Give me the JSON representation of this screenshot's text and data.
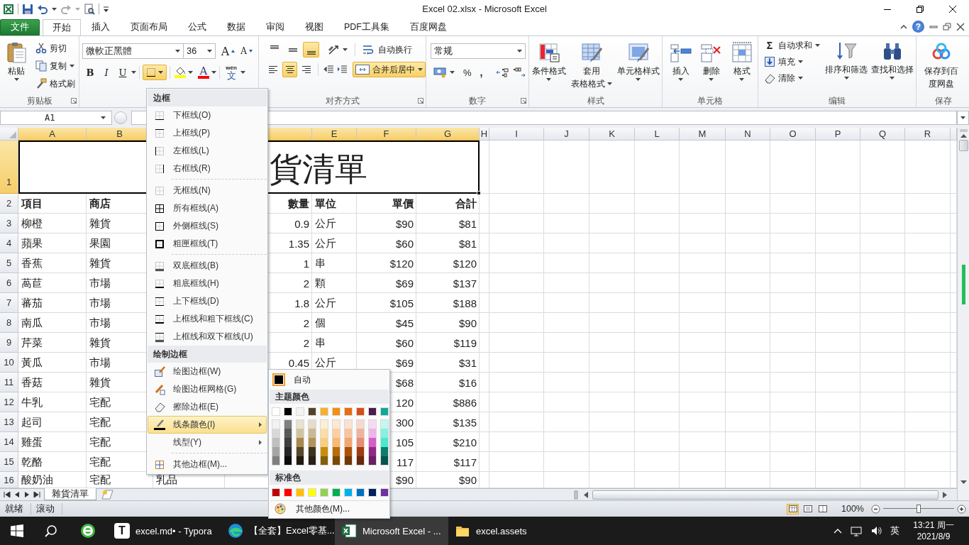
{
  "window": {
    "title": "Excel 02.xlsx - Microsoft Excel"
  },
  "tabs": [
    {
      "label": "文件",
      "kind": "file",
      "selected": false
    },
    {
      "label": "开始",
      "kind": "tab",
      "selected": true
    },
    {
      "label": "插入",
      "kind": "tab",
      "selected": false
    },
    {
      "label": "页面布局",
      "kind": "tab",
      "selected": false
    },
    {
      "label": "公式",
      "kind": "tab",
      "selected": false
    },
    {
      "label": "数据",
      "kind": "tab",
      "selected": false
    },
    {
      "label": "审阅",
      "kind": "tab",
      "selected": false
    },
    {
      "label": "视图",
      "kind": "tab",
      "selected": false
    },
    {
      "label": "PDF工具集",
      "kind": "tab",
      "selected": false
    },
    {
      "label": "百度网盘",
      "kind": "tab",
      "selected": false
    }
  ],
  "help": "?",
  "ribbon": {
    "groups": [
      {
        "kind": "clipboard",
        "label": "剪贴板",
        "launcher": true,
        "paste": "粘贴",
        "small": [
          {
            "label": "剪切",
            "dropdown": false
          },
          {
            "label": "复制",
            "dropdown": true
          },
          {
            "label": "格式刷",
            "dropdown": false
          }
        ]
      },
      {
        "kind": "font",
        "launcher": false,
        "font": "微軟正黑體",
        "size": "36",
        "grow": "A",
        "shrink": "A",
        "styles": [
          "B",
          "I",
          "U"
        ],
        "border_open": true,
        "fill": {
          "color": "#ffff00"
        },
        "font_color": {
          "label": "A",
          "color": "#ff0000"
        },
        "phonetic": [
          "wén",
          "文"
        ]
      },
      {
        "kind": "alignment",
        "label": "对齐方式",
        "launcher": true,
        "vertical": [
          {
            "on": false
          },
          {
            "on": false
          },
          {
            "on": true
          }
        ],
        "horizontal": [
          {
            "on": false
          },
          {
            "on": true
          },
          {
            "on": false
          }
        ],
        "wrap": "自动换行",
        "merge": {
          "label": "合并后居中",
          "on": true
        }
      },
      {
        "kind": "number",
        "label": "数字",
        "launcher": true,
        "format": "常规",
        "percent": "%",
        "comma": ","
      },
      {
        "kind": "large",
        "label": "样式",
        "launcher": false,
        "buttons": [
          {
            "lines": [
              "条件格式"
            ],
            "dropdown": true
          },
          {
            "lines": [
              "套用",
              "表格格式"
            ],
            "dropdown": true
          },
          {
            "lines": [
              "单元格样式"
            ],
            "dropdown": true
          }
        ]
      },
      {
        "kind": "cells",
        "label": "单元格",
        "launcher": false,
        "buttons": [
          {
            "lines": [
              "插入"
            ],
            "dropdown": true
          },
          {
            "lines": [
              "删除"
            ],
            "dropdown": true
          },
          {
            "lines": [
              "格式"
            ],
            "dropdown": true
          }
        ]
      },
      {
        "kind": "editing",
        "label": "编辑",
        "launcher": false,
        "sigma": "Σ",
        "small": [
          {
            "label": "自动求和",
            "dropdown": true
          },
          {
            "label": "填充",
            "dropdown": true
          },
          {
            "label": "清除",
            "dropdown": true
          }
        ],
        "buttons": [
          {
            "lines": [
              "排序和筛选"
            ],
            "dropdown": true
          },
          {
            "lines": [
              "查找和选择"
            ],
            "dropdown": true
          }
        ]
      },
      {
        "kind": "save",
        "label": "保存",
        "launcher": false,
        "buttons": [
          {
            "lines": [
              "保存到百",
              "度网盘"
            ],
            "dropdown": false
          }
        ]
      }
    ]
  },
  "formula_bar": {
    "name_box": "A1"
  },
  "sheet": {
    "columns": [
      {
        "label": "A",
        "selected": true
      },
      {
        "label": "B",
        "selected": true
      },
      {
        "selected": true
      },
      {
        "label": "E",
        "selected": true
      },
      {
        "label": "F",
        "selected": true
      },
      {
        "label": "G",
        "selected": true
      },
      {
        "label": "H",
        "selected": false
      },
      {
        "label": "I",
        "selected": false
      },
      {
        "label": "J",
        "selected": false
      },
      {
        "label": "K",
        "selected": false
      },
      {
        "label": "L",
        "selected": false
      },
      {
        "label": "M",
        "selected": false
      },
      {
        "label": "N",
        "selected": false
      },
      {
        "label": "O",
        "selected": false
      },
      {
        "label": "P",
        "selected": false
      },
      {
        "label": "Q",
        "selected": false
      },
      {
        "label": "R",
        "selected": false
      }
    ],
    "title_row": {
      "number": "1",
      "selected": true,
      "title": "貨清單"
    },
    "rows": [
      {
        "number": "2",
        "selected": false,
        "kind": "header",
        "cells": [
          "項目",
          "商店",
          null,
          "數量",
          "單位",
          "單價",
          "合計"
        ]
      },
      {
        "number": "3",
        "selected": false,
        "kind": "data",
        "cells": [
          "柳橙",
          "雜貨",
          null,
          "0.9",
          "公斤",
          "$90",
          "$81"
        ]
      },
      {
        "number": "4",
        "selected": false,
        "kind": "data",
        "cells": [
          "蘋果",
          "果園",
          null,
          "1.35",
          "公斤",
          "$60",
          "$81"
        ]
      },
      {
        "number": "5",
        "selected": false,
        "kind": "data",
        "cells": [
          "香蕉",
          "雜貨",
          null,
          "1",
          "串",
          "$120",
          "$120"
        ]
      },
      {
        "number": "6",
        "selected": false,
        "kind": "data",
        "cells": [
          "萵苣",
          "市場",
          null,
          "2",
          "顆",
          "$69",
          "$137"
        ]
      },
      {
        "number": "7",
        "selected": false,
        "kind": "data",
        "cells": [
          "蕃茄",
          "市場",
          null,
          "1.8",
          "公斤",
          "$105",
          "$188"
        ]
      },
      {
        "number": "8",
        "selected": false,
        "kind": "data",
        "cells": [
          "南瓜",
          "市場",
          null,
          "2",
          "個",
          "$45",
          "$90"
        ]
      },
      {
        "number": "9",
        "selected": false,
        "kind": "data",
        "cells": [
          "芹菜",
          "雜貨",
          null,
          "2",
          "串",
          "$60",
          "$119"
        ]
      },
      {
        "number": "10",
        "selected": false,
        "kind": "data",
        "cells": [
          "黃瓜",
          "市場",
          null,
          "0.45",
          "公斤",
          "$69",
          "$31"
        ]
      },
      {
        "number": "11",
        "selected": false,
        "kind": "data",
        "cells": [
          "香菇",
          "雜貨",
          null,
          null,
          null,
          "$68",
          "$16"
        ]
      },
      {
        "number": "12",
        "selected": false,
        "kind": "data",
        "cells": [
          "牛乳",
          "宅配",
          null,
          null,
          null,
          "120",
          "$886"
        ]
      },
      {
        "number": "13",
        "selected": false,
        "kind": "data",
        "cells": [
          "起司",
          "宅配",
          null,
          null,
          null,
          "300",
          "$135"
        ]
      },
      {
        "number": "14",
        "selected": false,
        "kind": "data",
        "cells": [
          "雞蛋",
          "宅配",
          null,
          null,
          null,
          "105",
          "$210"
        ]
      },
      {
        "number": "15",
        "selected": false,
        "kind": "data",
        "cells": [
          "乾酪",
          "宅配",
          null,
          null,
          null,
          "117",
          "$117"
        ]
      },
      {
        "number": "16",
        "selected": false,
        "kind": "data",
        "cells": [
          "酸奶油",
          "宅配",
          "乳品",
          null,
          null,
          "$90",
          "$90"
        ]
      }
    ],
    "sheet_tabs": [
      {
        "label": "雜貨清單",
        "selected": true
      }
    ]
  },
  "status_bar": {
    "items": [
      "就绪",
      "滚动"
    ],
    "views": [
      {
        "selected": true
      },
      {
        "selected": false
      },
      {
        "selected": false
      }
    ],
    "zoom": {
      "label": "100%",
      "level": 0.5
    }
  },
  "border_menu": {
    "sections": [
      {
        "title": "边框",
        "items": [
          {
            "kind": "item",
            "label": "下框线(O)",
            "selected": false,
            "has_submenu": false
          },
          {
            "kind": "item",
            "label": "上框线(P)",
            "selected": false,
            "has_submenu": false
          },
          {
            "kind": "item",
            "label": "左框线(L)",
            "selected": false,
            "has_submenu": false
          },
          {
            "kind": "item",
            "label": "右框线(R)",
            "selected": false,
            "has_submenu": false
          },
          {
            "kind": "separator"
          },
          {
            "kind": "item",
            "label": "无框线(N)",
            "selected": false,
            "has_submenu": false
          },
          {
            "kind": "item",
            "label": "所有框线(A)",
            "selected": false,
            "has_submenu": false
          },
          {
            "kind": "item",
            "label": "外侧框线(S)",
            "selected": false,
            "has_submenu": false
          },
          {
            "kind": "item",
            "label": "粗匣框线(T)",
            "selected": false,
            "has_submenu": false
          },
          {
            "kind": "separator"
          },
          {
            "kind": "item",
            "label": "双底框线(B)",
            "selected": false,
            "has_submenu": false
          },
          {
            "kind": "item",
            "label": "粗底框线(H)",
            "selected": false,
            "has_submenu": false
          },
          {
            "kind": "item",
            "label": "上下框线(D)",
            "selected": false,
            "has_submenu": false
          },
          {
            "kind": "item",
            "label": "上框线和粗下框线(C)",
            "selected": false,
            "has_submenu": false
          },
          {
            "kind": "item",
            "label": "上框线和双下框线(U)",
            "selected": false,
            "has_submenu": false
          }
        ]
      },
      {
        "title": "绘制边框",
        "items": [
          {
            "kind": "item",
            "label": "绘图边框(W)",
            "selected": false,
            "has_submenu": false
          },
          {
            "kind": "item",
            "label": "绘图边框网格(G)",
            "selected": false,
            "has_submenu": false
          },
          {
            "kind": "item",
            "label": "擦除边框(E)",
            "selected": false,
            "has_submenu": false
          },
          {
            "kind": "item",
            "label": "线条颜色(I)",
            "selected": true,
            "has_submenu": true
          },
          {
            "kind": "item",
            "label": "线型(Y)",
            "selected": false,
            "has_submenu": true
          },
          {
            "kind": "separator"
          },
          {
            "kind": "item",
            "label": "其他边框(M)...",
            "selected": false,
            "has_submenu": false
          }
        ]
      }
    ]
  },
  "color_menu": {
    "auto": {
      "label": "自动",
      "color": "#000000"
    },
    "theme_title": "主题颜色",
    "theme": [
      {
        "color": "#ffffff"
      },
      {
        "color": "#000000"
      },
      {
        "color": "#f4f4ee"
      },
      {
        "color": "#54432a"
      },
      {
        "color": "#f6b02a"
      },
      {
        "color": "#f38f12"
      },
      {
        "color": "#e86c10"
      },
      {
        "color": "#d54e1a"
      },
      {
        "color": "#4e1a4a"
      },
      {
        "color": "#10a896"
      }
    ],
    "shades": [
      {
        "swatches": [
          {
            "color": "#f2f2f2"
          },
          {
            "color": "#7f7f7f"
          },
          {
            "color": "#e7e1d2"
          },
          {
            "color": "#e5dcc9"
          },
          {
            "color": "#fdefd4"
          },
          {
            "color": "#fde8d0"
          },
          {
            "color": "#fbe1cf"
          },
          {
            "color": "#f6d9cf"
          },
          {
            "color": "#f5dbf2"
          },
          {
            "color": "#c3f7ef"
          }
        ]
      },
      {
        "swatches": [
          {
            "color": "#d8d8d8"
          },
          {
            "color": "#595959"
          },
          {
            "color": "#d2c3a0"
          },
          {
            "color": "#cbb791"
          },
          {
            "color": "#fbdea8"
          },
          {
            "color": "#fbd0a0"
          },
          {
            "color": "#f7c49f"
          },
          {
            "color": "#eeb39f"
          },
          {
            "color": "#ebb6e5"
          },
          {
            "color": "#87f0df"
          }
        ]
      },
      {
        "swatches": [
          {
            "color": "#bfbfbf"
          },
          {
            "color": "#3f3f3f"
          },
          {
            "color": "#a8894b"
          },
          {
            "color": "#b1945a"
          },
          {
            "color": "#f9ce7e"
          },
          {
            "color": "#f9b972"
          },
          {
            "color": "#f3a670"
          },
          {
            "color": "#e68e70"
          },
          {
            "color": "#d45fc7"
          },
          {
            "color": "#4ae8cf"
          }
        ]
      },
      {
        "swatches": [
          {
            "color": "#a5a5a5"
          },
          {
            "color": "#262626"
          },
          {
            "color": "#574829"
          },
          {
            "color": "#3f321e"
          },
          {
            "color": "#c88e0b"
          },
          {
            "color": "#b86c0a"
          },
          {
            "color": "#ae5009"
          },
          {
            "color": "#a03a13"
          },
          {
            "color": "#8f2986"
          },
          {
            "color": "#0c7e6f"
          }
        ]
      },
      {
        "swatches": [
          {
            "color": "#7f7f7f"
          },
          {
            "color": "#0c0c0c"
          },
          {
            "color": "#201a10"
          },
          {
            "color": "#2a2114"
          },
          {
            "color": "#855f07"
          },
          {
            "color": "#7b4806"
          },
          {
            "color": "#743606"
          },
          {
            "color": "#6a270d"
          },
          {
            "color": "#6b1f63"
          },
          {
            "color": "#08544a"
          }
        ]
      }
    ],
    "standard_title": "标准色",
    "standard": [
      {
        "color": "#c00000"
      },
      {
        "color": "#ff0000"
      },
      {
        "color": "#ffc000"
      },
      {
        "color": "#ffff00"
      },
      {
        "color": "#92d050"
      },
      {
        "color": "#00b050"
      },
      {
        "color": "#00b0f0"
      },
      {
        "color": "#0070c0"
      },
      {
        "color": "#002060"
      },
      {
        "color": "#7030a0"
      }
    ],
    "more": "其他颜色(M)..."
  },
  "taskbar": {
    "apps": [
      {
        "kind": "browser",
        "selected": false
      },
      {
        "kind": "typora",
        "badge": "T",
        "label": "excel.md• - Typora",
        "selected": false
      },
      {
        "kind": "edge",
        "label": "【全套】Excel零基...",
        "selected": false
      },
      {
        "kind": "excel",
        "label": "Microsoft Excel - ...",
        "selected": true
      },
      {
        "kind": "folder",
        "label": "excel.assets",
        "selected": false
      }
    ],
    "tray": {
      "ime": "英",
      "time": "13:21 周一",
      "date": "2021/8/9"
    }
  }
}
